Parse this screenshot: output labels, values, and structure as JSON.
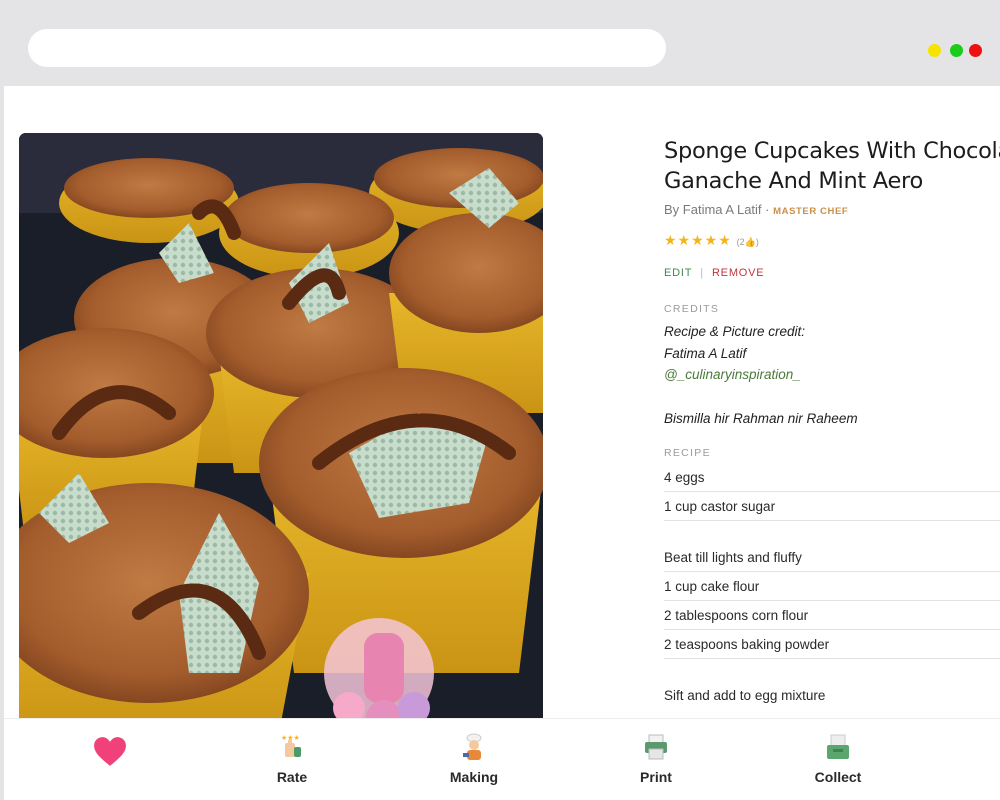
{
  "recipe": {
    "title_line1": "Sponge Cupcakes With Chocolate",
    "title_line2": "Ganache And Mint Aero",
    "author": "By Fatima A Latif",
    "byline_sep": " · ",
    "author_badge": "MASTER CHEF",
    "rating_stars": "★★★★★",
    "rating_count": "(2👍)",
    "rating_value": 5,
    "rating_max": 5,
    "photo_icon": "cupcakes-photo"
  },
  "actions": {
    "edit": "EDIT",
    "separator": "|",
    "remove": "REMOVE"
  },
  "credits": {
    "label": "CREDITS",
    "lines": [
      "Recipe & Picture credit:",
      "Fatima A Latif",
      "@_culinaryinspiration_",
      "Bismilla hir Rahman nir Raheem"
    ]
  },
  "ingredients": {
    "label": "RECIPE",
    "items": [
      "4 eggs",
      "1 cup castor sugar",
      "Beat till lights and fluffy",
      "1 cup cake flour",
      "2 tablespoons corn flour",
      "2 teaspoons baking powder",
      "Sift and add to egg mixture"
    ]
  },
  "bottom_bar": {
    "tabs": [
      {
        "label": "",
        "icon": "heart-icon"
      },
      {
        "label": "Rate",
        "icon": "rate-icon"
      },
      {
        "label": "Making",
        "icon": "chef-icon"
      },
      {
        "label": "Print",
        "icon": "printer-icon"
      },
      {
        "label": "Collect",
        "icon": "collect-icon"
      }
    ]
  },
  "colors": {
    "accent_green": "#3f8a4c",
    "remove_red": "#c1353b",
    "badge_gold": "#c9904a",
    "star_gold": "#f3b51d",
    "heart_pink": "#f0417a"
  }
}
